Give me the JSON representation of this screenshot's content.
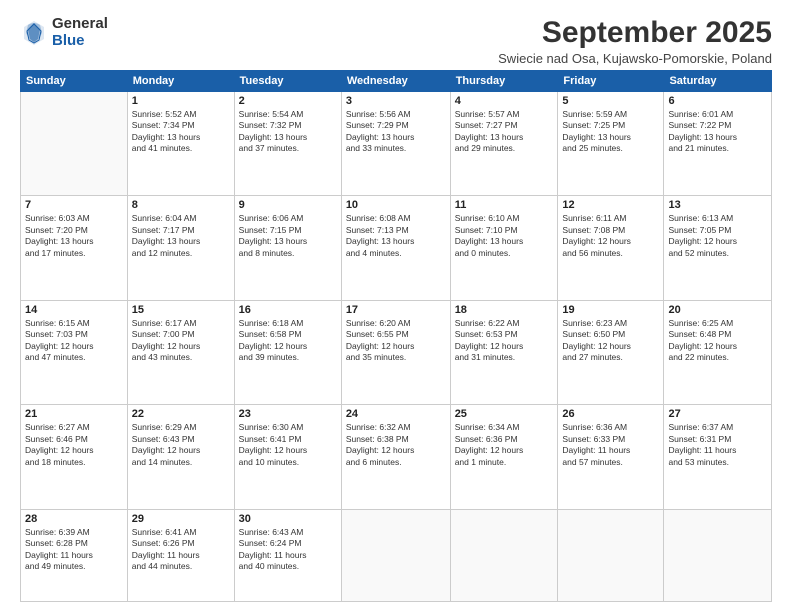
{
  "logo": {
    "general": "General",
    "blue": "Blue"
  },
  "title": "September 2025",
  "location": "Swiecie nad Osa, Kujawsko-Pomorskie, Poland",
  "headers": [
    "Sunday",
    "Monday",
    "Tuesday",
    "Wednesday",
    "Thursday",
    "Friday",
    "Saturday"
  ],
  "weeks": [
    [
      {
        "day": "",
        "info": ""
      },
      {
        "day": "1",
        "info": "Sunrise: 5:52 AM\nSunset: 7:34 PM\nDaylight: 13 hours\nand 41 minutes."
      },
      {
        "day": "2",
        "info": "Sunrise: 5:54 AM\nSunset: 7:32 PM\nDaylight: 13 hours\nand 37 minutes."
      },
      {
        "day": "3",
        "info": "Sunrise: 5:56 AM\nSunset: 7:29 PM\nDaylight: 13 hours\nand 33 minutes."
      },
      {
        "day": "4",
        "info": "Sunrise: 5:57 AM\nSunset: 7:27 PM\nDaylight: 13 hours\nand 29 minutes."
      },
      {
        "day": "5",
        "info": "Sunrise: 5:59 AM\nSunset: 7:25 PM\nDaylight: 13 hours\nand 25 minutes."
      },
      {
        "day": "6",
        "info": "Sunrise: 6:01 AM\nSunset: 7:22 PM\nDaylight: 13 hours\nand 21 minutes."
      }
    ],
    [
      {
        "day": "7",
        "info": "Sunrise: 6:03 AM\nSunset: 7:20 PM\nDaylight: 13 hours\nand 17 minutes."
      },
      {
        "day": "8",
        "info": "Sunrise: 6:04 AM\nSunset: 7:17 PM\nDaylight: 13 hours\nand 12 minutes."
      },
      {
        "day": "9",
        "info": "Sunrise: 6:06 AM\nSunset: 7:15 PM\nDaylight: 13 hours\nand 8 minutes."
      },
      {
        "day": "10",
        "info": "Sunrise: 6:08 AM\nSunset: 7:13 PM\nDaylight: 13 hours\nand 4 minutes."
      },
      {
        "day": "11",
        "info": "Sunrise: 6:10 AM\nSunset: 7:10 PM\nDaylight: 13 hours\nand 0 minutes."
      },
      {
        "day": "12",
        "info": "Sunrise: 6:11 AM\nSunset: 7:08 PM\nDaylight: 12 hours\nand 56 minutes."
      },
      {
        "day": "13",
        "info": "Sunrise: 6:13 AM\nSunset: 7:05 PM\nDaylight: 12 hours\nand 52 minutes."
      }
    ],
    [
      {
        "day": "14",
        "info": "Sunrise: 6:15 AM\nSunset: 7:03 PM\nDaylight: 12 hours\nand 47 minutes."
      },
      {
        "day": "15",
        "info": "Sunrise: 6:17 AM\nSunset: 7:00 PM\nDaylight: 12 hours\nand 43 minutes."
      },
      {
        "day": "16",
        "info": "Sunrise: 6:18 AM\nSunset: 6:58 PM\nDaylight: 12 hours\nand 39 minutes."
      },
      {
        "day": "17",
        "info": "Sunrise: 6:20 AM\nSunset: 6:55 PM\nDaylight: 12 hours\nand 35 minutes."
      },
      {
        "day": "18",
        "info": "Sunrise: 6:22 AM\nSunset: 6:53 PM\nDaylight: 12 hours\nand 31 minutes."
      },
      {
        "day": "19",
        "info": "Sunrise: 6:23 AM\nSunset: 6:50 PM\nDaylight: 12 hours\nand 27 minutes."
      },
      {
        "day": "20",
        "info": "Sunrise: 6:25 AM\nSunset: 6:48 PM\nDaylight: 12 hours\nand 22 minutes."
      }
    ],
    [
      {
        "day": "21",
        "info": "Sunrise: 6:27 AM\nSunset: 6:46 PM\nDaylight: 12 hours\nand 18 minutes."
      },
      {
        "day": "22",
        "info": "Sunrise: 6:29 AM\nSunset: 6:43 PM\nDaylight: 12 hours\nand 14 minutes."
      },
      {
        "day": "23",
        "info": "Sunrise: 6:30 AM\nSunset: 6:41 PM\nDaylight: 12 hours\nand 10 minutes."
      },
      {
        "day": "24",
        "info": "Sunrise: 6:32 AM\nSunset: 6:38 PM\nDaylight: 12 hours\nand 6 minutes."
      },
      {
        "day": "25",
        "info": "Sunrise: 6:34 AM\nSunset: 6:36 PM\nDaylight: 12 hours\nand 1 minute."
      },
      {
        "day": "26",
        "info": "Sunrise: 6:36 AM\nSunset: 6:33 PM\nDaylight: 11 hours\nand 57 minutes."
      },
      {
        "day": "27",
        "info": "Sunrise: 6:37 AM\nSunset: 6:31 PM\nDaylight: 11 hours\nand 53 minutes."
      }
    ],
    [
      {
        "day": "28",
        "info": "Sunrise: 6:39 AM\nSunset: 6:28 PM\nDaylight: 11 hours\nand 49 minutes."
      },
      {
        "day": "29",
        "info": "Sunrise: 6:41 AM\nSunset: 6:26 PM\nDaylight: 11 hours\nand 44 minutes."
      },
      {
        "day": "30",
        "info": "Sunrise: 6:43 AM\nSunset: 6:24 PM\nDaylight: 11 hours\nand 40 minutes."
      },
      {
        "day": "",
        "info": ""
      },
      {
        "day": "",
        "info": ""
      },
      {
        "day": "",
        "info": ""
      },
      {
        "day": "",
        "info": ""
      }
    ]
  ]
}
